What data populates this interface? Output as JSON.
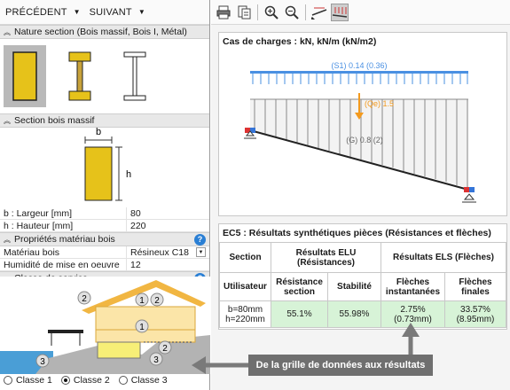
{
  "nav": {
    "prev_label": "PRÉCÉDENT",
    "next_label": "SUIVANT"
  },
  "sections": {
    "nature": "Nature section (Bois massif, Bois I, Métal)",
    "bois_massif": "Section bois massif",
    "materiau": "Propriétés matériau bois",
    "classe": "Classe de service"
  },
  "section_dims": {
    "b_label": "b",
    "h_label": "h"
  },
  "properties": [
    {
      "key": "b : Largeur  [mm]",
      "value": "80"
    },
    {
      "key": "h : Hauteur  [mm]",
      "value": "220"
    }
  ],
  "materials": [
    {
      "key": "Matériau bois",
      "value": "Résineux C18"
    },
    {
      "key": "Humidité de mise en oeuvre",
      "value": "12"
    }
  ],
  "house_labels": {
    "l1": "1",
    "l2": "2",
    "l3": "3"
  },
  "radio_options": [
    {
      "label": "Classe 1",
      "selected": false
    },
    {
      "label": "Classe 2",
      "selected": true
    },
    {
      "label": "Classe 3",
      "selected": false
    }
  ],
  "load_panel": {
    "title": "Cas de charges : kN, kN/m (kN/m2)",
    "s1": "(S1) 0.14 (0.36)",
    "qe": "(Qe) 1.5",
    "g": "(G) 0.8 (2)"
  },
  "results": {
    "title": "EC5 : Résultats synthétiques pièces (Résistances et flèches)",
    "h_section": "Section",
    "h_elu": "Résultats ELU (Résistances)",
    "h_els": "Résultats ELS (Flèches)",
    "h_user": "Utilisateur",
    "h_res": "Résistance section",
    "h_stab": "Stabilité",
    "h_fi": "Flèches instantanées",
    "h_ff": "Flèches finales",
    "row_section": "b=80mm h=220mm",
    "v_res": "55.1%",
    "v_stab": "55.98%",
    "v_fi": "2.75% (0.73mm)",
    "v_ff": "33.57% (8.95mm)"
  },
  "callout": "De la grille de données aux résultats",
  "colors": {
    "wood": "#e6c21a",
    "blue_load": "#4a90e2",
    "orange_load": "#f39a1e",
    "green_cell": "#d7f3d7",
    "help": "#2a7fd4"
  }
}
